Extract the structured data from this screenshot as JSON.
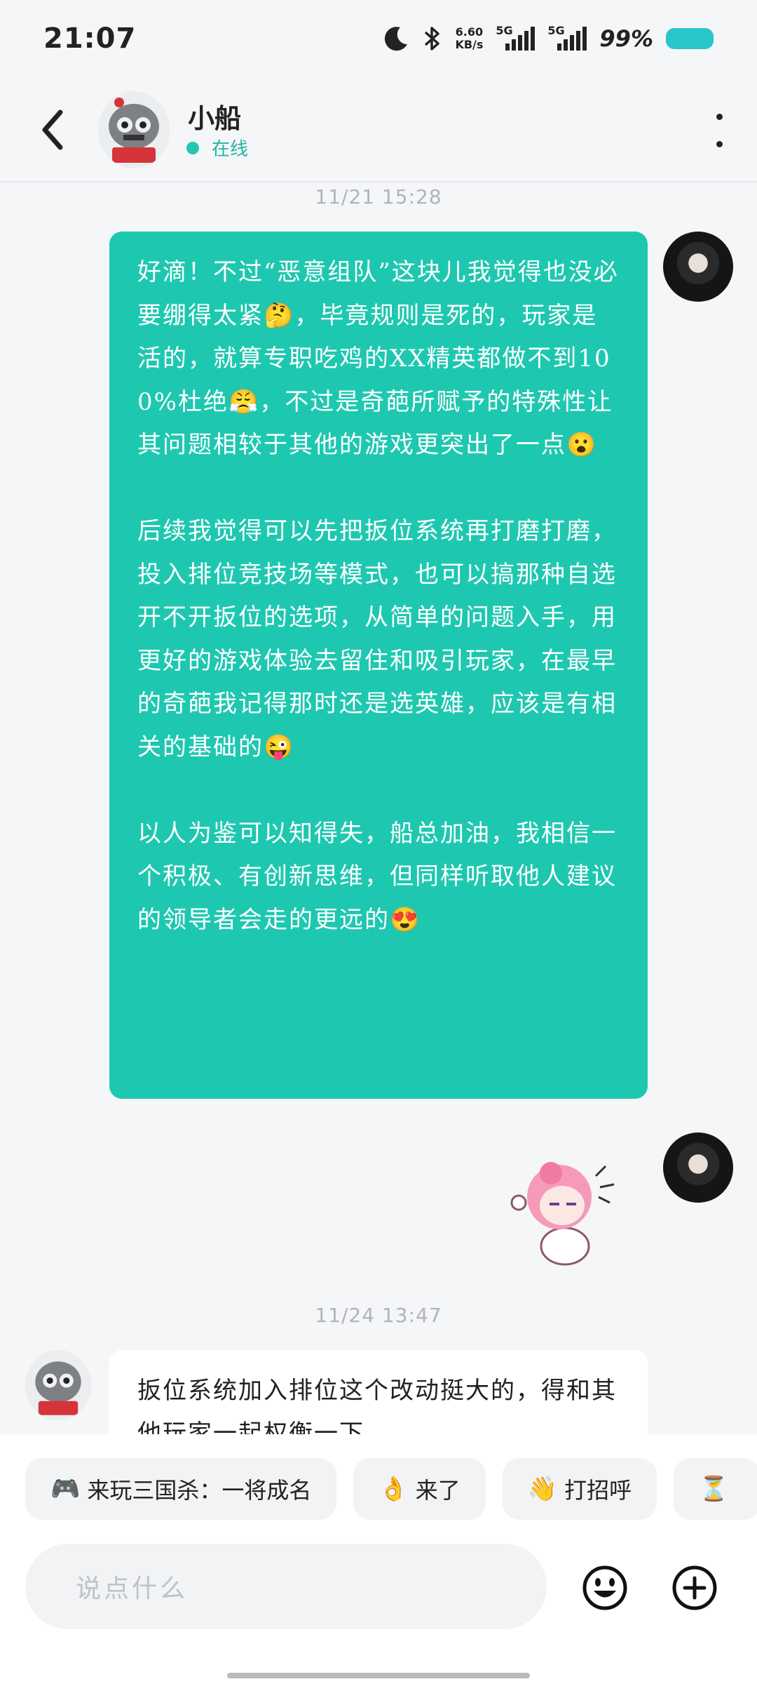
{
  "status_bar": {
    "time": "21:07",
    "net_speed_value": "6.60",
    "net_speed_unit": "KB/s",
    "signal1_label": "5G",
    "signal2_label": "5G",
    "battery_percent": "99%",
    "battery_color": "#29c7c9"
  },
  "header": {
    "chat_name": "小船",
    "online_status": "在线",
    "online_color": "#22c7b2"
  },
  "messages": {
    "timestamp1": "11/21  15:28",
    "outgoing_paragraphs": [
      "好滴！不过“恶意组队”这块儿我觉得也没必要绷得太紧🤔，毕竟规则是死的，玩家是活的，就算专职吃鸡的XX精英都做不到100%杜绝😤，不过是奇葩所赋予的特殊性让其问题相较于其他的游戏更突出了一点😮",
      "后续我觉得可以先把扳位系统再打磨打磨，投入排位竞技场等模式，也可以搞那种自选开不开扳位的选项，从简单的问题入手，用更好的游戏体验去留住和吸引玩家，在最早的奇葩我记得那时还是选英雄，应该是有相关的基础的😜",
      "以人为鉴可以知得失，船总加油，我相信一个积极、有创新思维，但同样听取他人建议的领导者会走的更远的😍"
    ],
    "outgoing_bubble_color": "#1ec8b0",
    "timestamp2": "11/24  13:47",
    "incoming_text": "扳位系统加入排位这个改动挺大的，得和其他玩家一起权衡一下"
  },
  "quick_replies": [
    {
      "icon": "🎮",
      "label": "来玩三国杀：一将成名"
    },
    {
      "icon": "👌",
      "label": "来了"
    },
    {
      "icon": "👋",
      "label": "打招呼"
    },
    {
      "icon": "⏳",
      "label": ""
    }
  ],
  "composer": {
    "placeholder": "说点什么"
  }
}
